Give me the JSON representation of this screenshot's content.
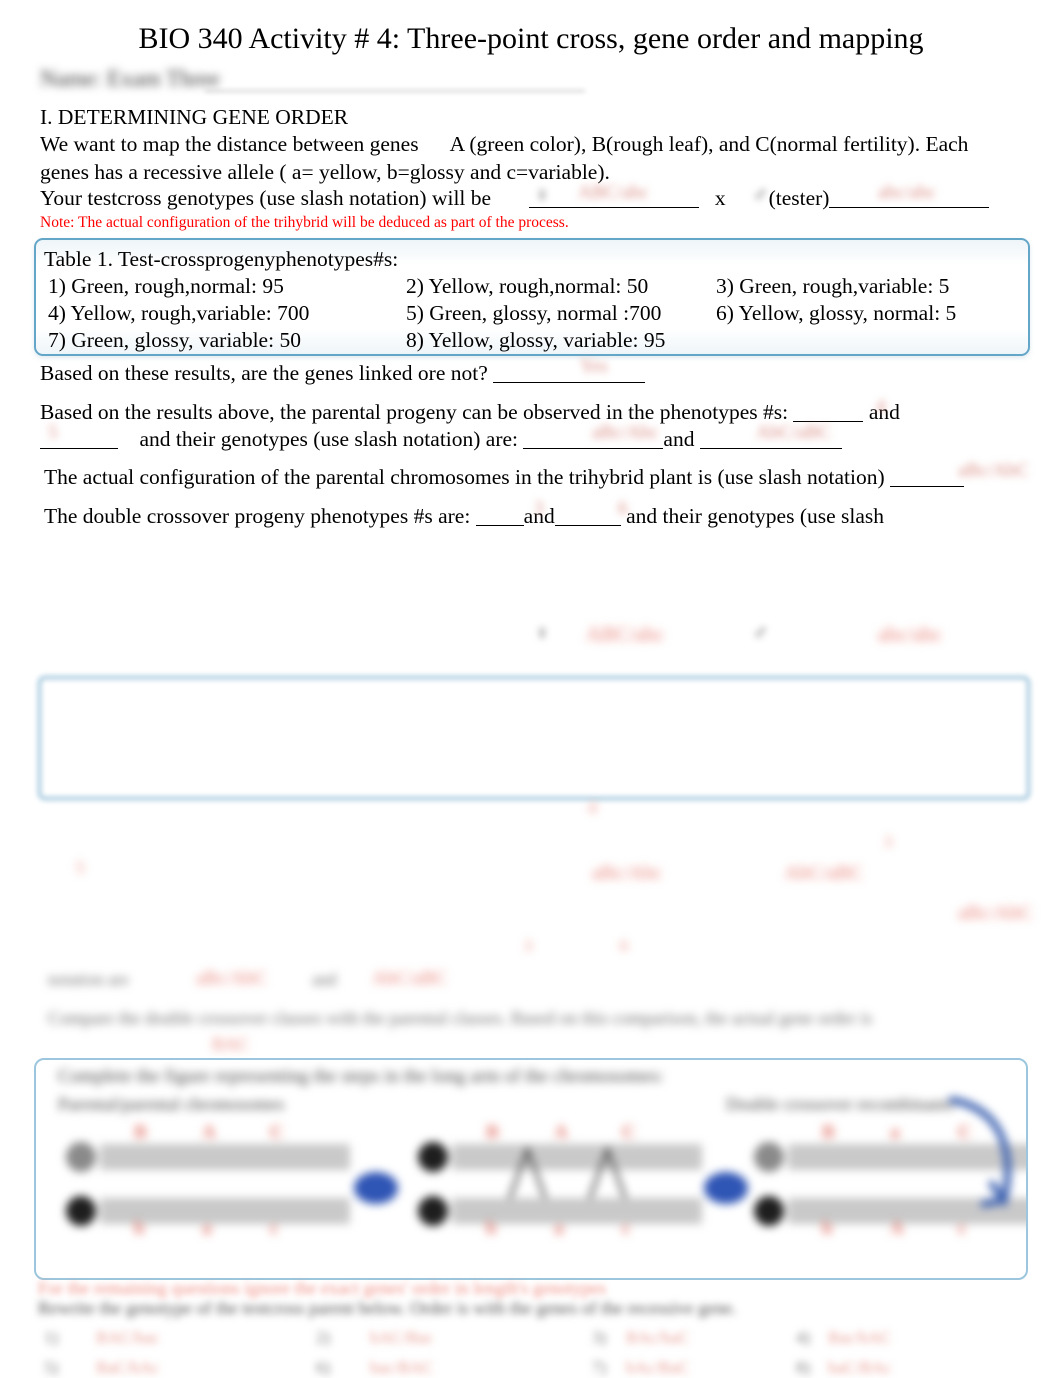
{
  "document": {
    "title": "BIO 340 Activity # 4: Three-point cross, gene order and mapping",
    "name_field_redacted": "Name: Exam Three",
    "section_heading": "I. DETERMINING GENE ORDER",
    "intro_line1": "We want to map the distance between genes",
    "intro_genes": "A (green color), B(rough leaf), and C(normal fertility). Each",
    "intro_line2": "genes has a recessive allele ( a= yellow, b=glossy and c=variable).",
    "testcross_label": "Your testcross genotypes (use slash notation) will be",
    "testcross_x": "x",
    "testcross_tester": "(tester)",
    "note": "Note: The actual configuration of the trihybrid will be deduced as part of the process."
  },
  "table": {
    "caption": "Table 1. Test-crossprogenyphenotypes#s:",
    "rows": [
      [
        "1) Green, rough,normal: 95",
        "2) Yellow, rough,normal: 50",
        "3) Green, rough,variable: 5"
      ],
      [
        "4) Yellow, rough,variable: 700",
        "5) Green, glossy, normal :700",
        "6) Yellow, glossy, normal: 5"
      ],
      [
        "7) Green, glossy, variable: 50",
        "8) Yellow, glossy, variable: 95",
        ""
      ]
    ]
  },
  "questions": {
    "linked": "Based on these results, are the genes linked ore not?",
    "parental_a": "Based on the results above, the parental progeny can be observed in the phenotypes #s:",
    "parental_and": "and",
    "parental_b_pre": "and their genotypes (use slash notation) are:",
    "parental_b_and": "and",
    "configuration": "The actual configuration of the parental chromosomes   in the trihybrid plant   is (use slash notation)",
    "double_crossover_pre": "The double crossover  progeny phenotypes #s are:",
    "double_crossover_and": "and",
    "double_crossover_post": "and their genotypes (use slash"
  },
  "redacted": {
    "answer_blur_1": "ABC/abc",
    "answer_blur_2": "abc/abc",
    "answer_blur_3": "4",
    "answer_blur_4": "5",
    "answer_blur_5": "aBc/Abc",
    "answer_blur_6": "AbC/aBC",
    "answer_blur_7": "aBc/AbC",
    "answer_blur_8": "3",
    "answer_blur_9": "6",
    "answer_blur_10": "Yes",
    "answer_blur_11": "ABC",
    "answer_blur_12": "abc",
    "genotype_mid_1": "ABC/abc",
    "genotype_mid_2": "abc/abc",
    "mid_text_1": "notation are",
    "mid_text_2": "aBc/AbC",
    "mid_text_3": "and",
    "mid_text_4": "AbC/aBC",
    "mid_paragraph": "Compare the double crossover classes with the parental classes. Based on this comparison, the actual gene order is",
    "mid_order": "BAC",
    "diagram_heading": "Complete the figure representing the steps in the long arm of the chromosomes:",
    "diagram_label_left": "Parental/parental chromosomes",
    "diagram_label_right": "Double crossover recombinants",
    "bottom_red": "For the remaining questions ignore the exact genes' order in length's genotypes",
    "bottom_question": "Rewrite the genotype of the testcross parent below. Order is with the genes   of the recessive gene."
  },
  "diagram": {
    "alleles_left": [
      "B",
      "A",
      "C"
    ],
    "alleles_left_lower": [
      "b",
      "a",
      "c"
    ],
    "alleles_mid": [
      "B",
      "A",
      "C"
    ],
    "alleles_mid_lower": [
      "b",
      "a",
      "c"
    ],
    "alleles_right": [
      "B",
      "a",
      "C"
    ],
    "alleles_right_lower": [
      "b",
      "A",
      "c"
    ],
    "connector_color": "#2f55b5",
    "box_border_color": "#9cc6dd"
  },
  "bottom_grid": {
    "cells": [
      {
        "label": "1)",
        "value": "BAC/bac"
      },
      {
        "label": "2)",
        "value": "bAC/Bac"
      },
      {
        "label": "3)",
        "value": "BAc/baC"
      },
      {
        "label": "4)",
        "value": "Bac/bAC"
      },
      {
        "label": "5)",
        "value": "BaC/bAc"
      },
      {
        "label": "6)",
        "value": "bac/BAC"
      },
      {
        "label": "7)",
        "value": "bAc/BaC"
      },
      {
        "label": "8)",
        "value": "baC/BAc"
      }
    ]
  },
  "colors": {
    "accent_border": "#63a6c8",
    "note_red": "#ff0000",
    "redaction_red": "#d98f86",
    "diagram_blue": "#2f55b5"
  }
}
